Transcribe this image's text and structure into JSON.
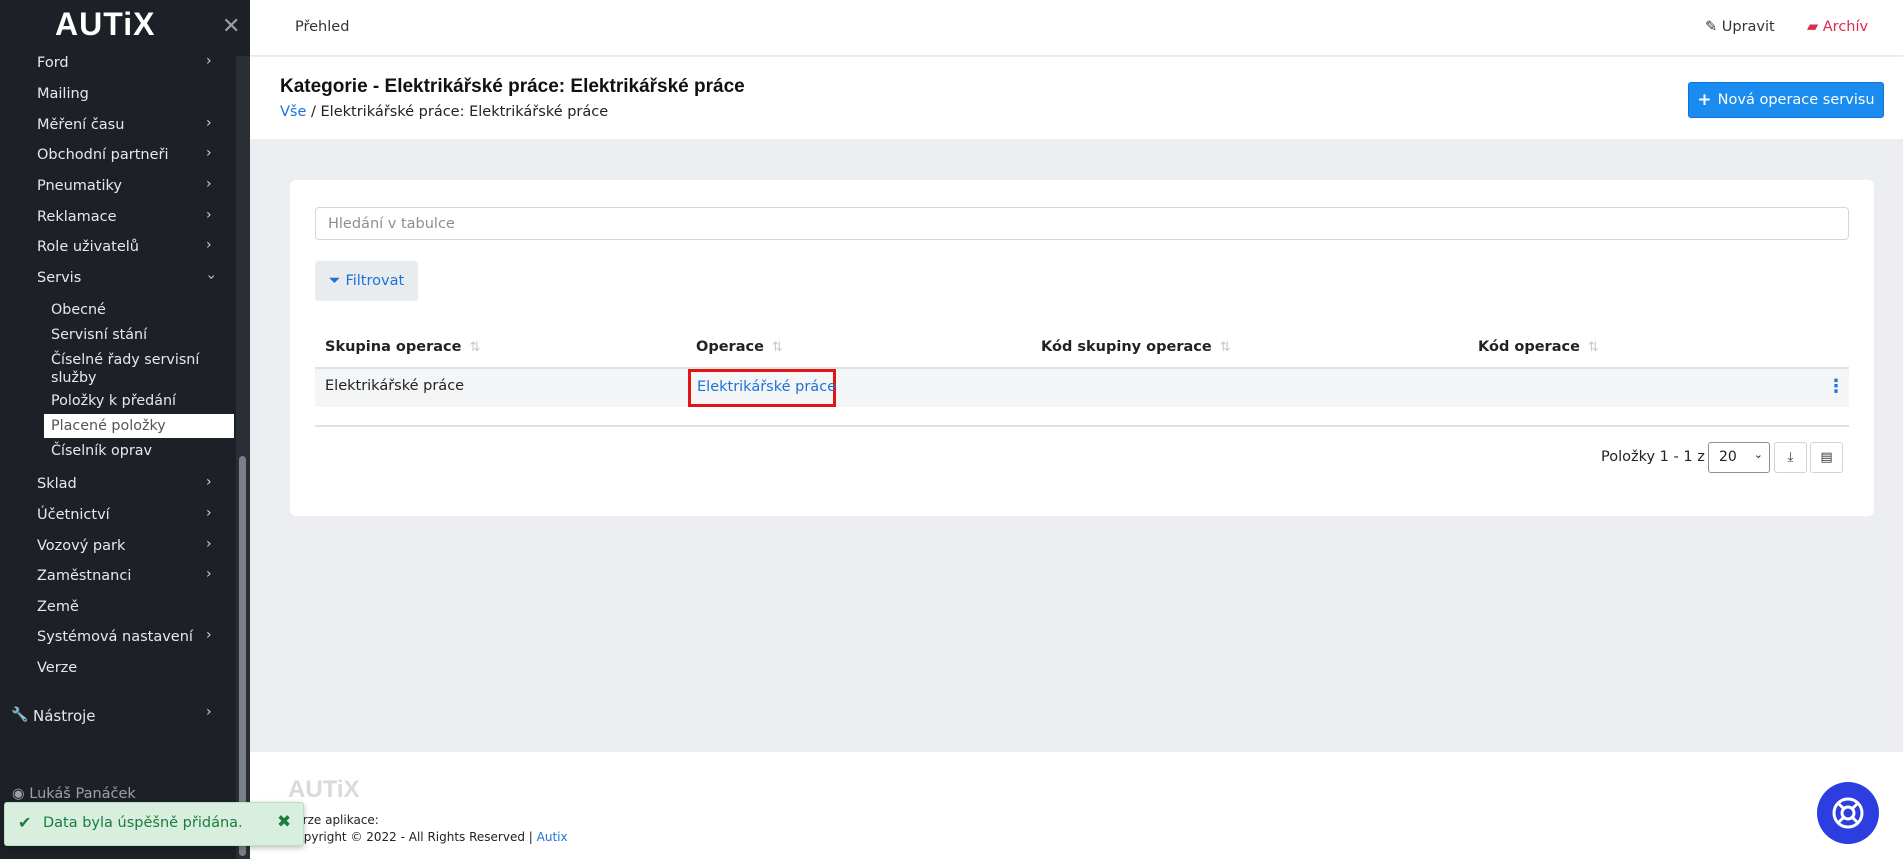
{
  "sidebar": {
    "logo": "AUTiX",
    "items": [
      {
        "label": "Ford",
        "has_children": true
      },
      {
        "label": "Mailing",
        "has_children": false
      },
      {
        "label": "Měření času",
        "has_children": true
      },
      {
        "label": "Obchodní partneři",
        "has_children": true
      },
      {
        "label": "Pneumatiky",
        "has_children": true
      },
      {
        "label": "Reklamace",
        "has_children": true
      },
      {
        "label": "Role uživatelů",
        "has_children": true
      },
      {
        "label": "Servis",
        "has_children": true,
        "expanded": true
      },
      {
        "label": "Sklad",
        "has_children": true
      },
      {
        "label": "Účetnictví",
        "has_children": true
      },
      {
        "label": "Vozový park",
        "has_children": true
      },
      {
        "label": "Zaměstnanci",
        "has_children": true
      },
      {
        "label": "Země",
        "has_children": false
      },
      {
        "label": "Systémová nastavení",
        "has_children": true
      },
      {
        "label": "Verze",
        "has_children": false
      }
    ],
    "servis_children": [
      {
        "label": "Obecné"
      },
      {
        "label": "Servisní stání"
      },
      {
        "label": "Číselné řady servisní služby"
      },
      {
        "label": "Položky k předání"
      },
      {
        "label": "Placené položky",
        "active": true
      },
      {
        "label": "Číselník oprav"
      }
    ],
    "tools_label": "Nástroje",
    "user_name": "Lukáš Panáček"
  },
  "topbar": {
    "overview": "Přehled",
    "edit": "Upravit",
    "archive": "Archív"
  },
  "page": {
    "title": "Kategorie - Elektrikářské práce: Elektrikářské práce",
    "breadcrumb_root": "Vše",
    "breadcrumb_sep": "/",
    "breadcrumb_current": "Elektrikářské práce: Elektrikářské práce",
    "new_button": "Nová operace servisu"
  },
  "table": {
    "search_placeholder": "Hledání v tabulce",
    "filter_label": "Filtrovat",
    "columns": [
      "Skupina operace",
      "Operace",
      "Kód skupiny operace",
      "Kód operace"
    ],
    "rows": [
      {
        "group": "Elektrikářské práce",
        "operation": "Elektrikářské práce",
        "group_code": "",
        "code": ""
      }
    ],
    "pager_text": "Položky 1 - 1 z 1",
    "page_size": "20"
  },
  "footer": {
    "logo": "AUTiX",
    "version_label": "Verze aplikace:",
    "copyright": "Copyright © 2022 - All Rights Reserved |",
    "brand_link": "Autix"
  },
  "toast": {
    "message": "Data byla úspěšně přidána."
  },
  "colors": {
    "sidebar_bg": "#1d2127",
    "primary": "#1a8cf0",
    "link": "#1a73d9",
    "archive": "#e0274e",
    "highlight_border": "#e01616",
    "toast_bg": "#d8efe0",
    "help_bubble": "#2c3ee0"
  }
}
